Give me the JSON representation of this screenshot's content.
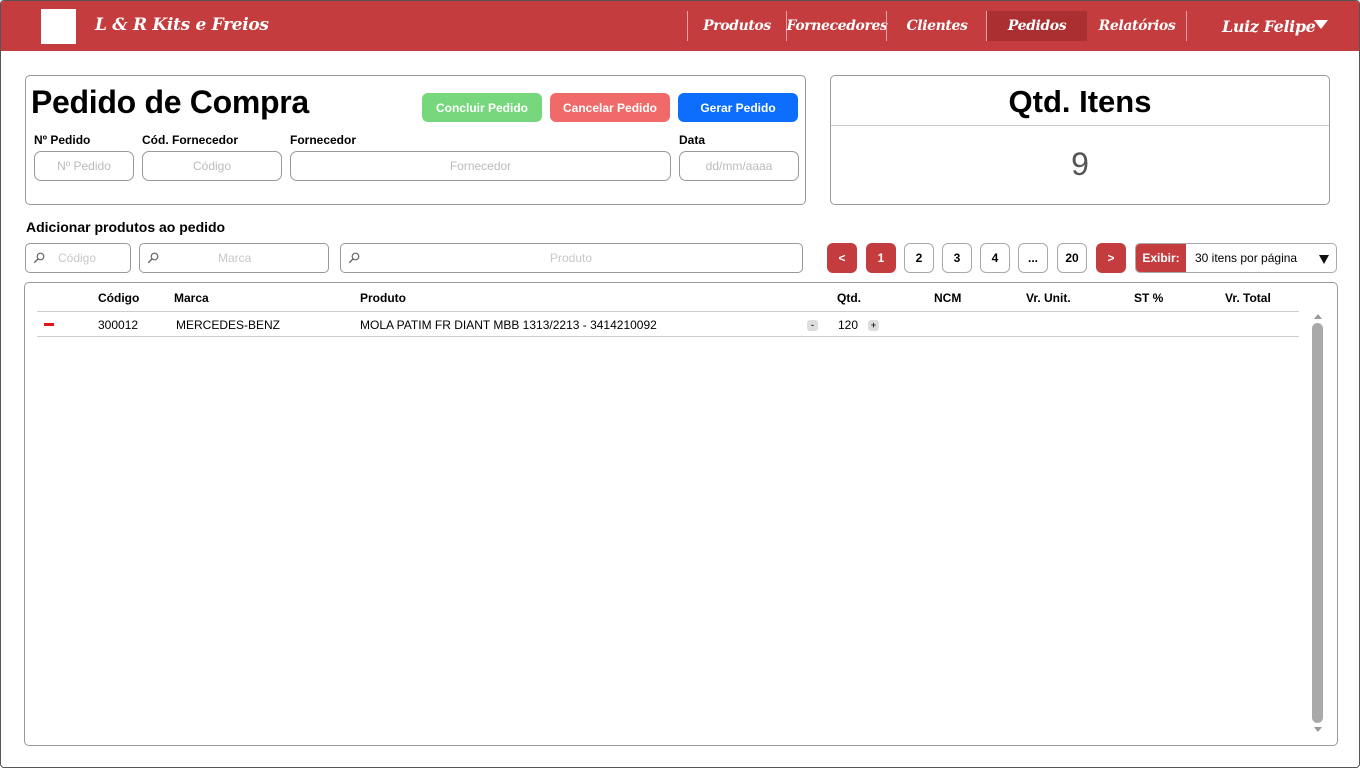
{
  "app": {
    "brand": "L & R Kits e Freios",
    "brand_color": "#c43c3e"
  },
  "nav": {
    "items": [
      {
        "label": "Produtos"
      },
      {
        "label": "Fornecedores"
      },
      {
        "label": "Clientes"
      },
      {
        "label": "Pedidos",
        "active": true
      },
      {
        "label": "Relatórios"
      }
    ],
    "user": "Luiz Felipe"
  },
  "order": {
    "title": "Pedido de Compra",
    "buttons": {
      "conclude": "Concluir Pedido",
      "cancel": "Cancelar Pedido",
      "generate": "Gerar Pedido"
    },
    "fields": {
      "order_no": {
        "label": "Nº Pedido",
        "placeholder": "Nº Pedido"
      },
      "supplier_code": {
        "label": "Cód. Fornecedor",
        "placeholder": "Código"
      },
      "supplier": {
        "label": "Fornecedor",
        "placeholder": "Fornecedor"
      },
      "date": {
        "label": "Data",
        "placeholder": "dd/mm/aaaa"
      }
    }
  },
  "quantity": {
    "title": "Qtd. Itens",
    "value": "9"
  },
  "add_products": {
    "title": "Adicionar produtos ao pedido",
    "search": {
      "code_placeholder": "Código",
      "brand_placeholder": "Marca",
      "product_placeholder": "Produto"
    }
  },
  "pagination": {
    "prev": "<",
    "pages": [
      "1",
      "2",
      "3",
      "4",
      "...",
      "20"
    ],
    "current": "1",
    "next": ">",
    "show_label": "Exibir:",
    "per_page": "30 itens por página"
  },
  "table": {
    "headers": {
      "code": "Código",
      "brand": "Marca",
      "product": "Produto",
      "qty": "Qtd.",
      "ncm": "NCM",
      "unit_price": "Vr. Unit.",
      "st": "ST %",
      "total": "Vr. Total"
    },
    "rows": [
      {
        "code": "300012",
        "brand": "MERCEDES-BENZ",
        "product": "MOLA PATIM FR DIANT MBB 1313/2213 -  3414210092",
        "qty": "120",
        "minus": "-",
        "plus": "+"
      }
    ]
  }
}
